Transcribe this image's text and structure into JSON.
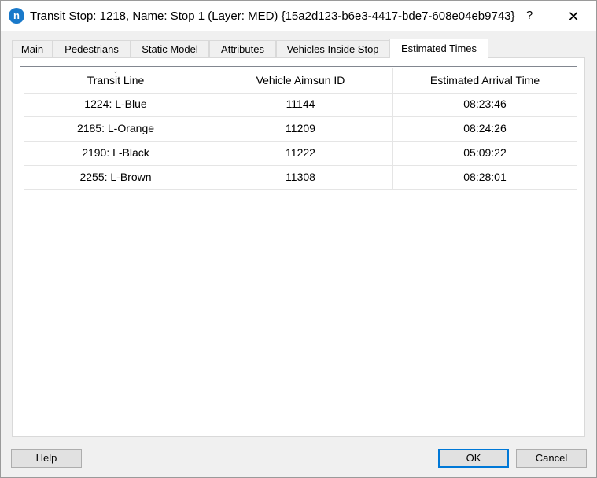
{
  "window": {
    "app_icon_letter": "n",
    "title": "Transit Stop: 1218, Name: Stop 1 (Layer: MED) {15a2d123-b6e3-4417-bde7-608e04eb9743}",
    "help_label": "?",
    "close_label": "✕"
  },
  "tabs": [
    {
      "label": "Main"
    },
    {
      "label": "Pedestrians"
    },
    {
      "label": "Static Model"
    },
    {
      "label": "Attributes"
    },
    {
      "label": "Vehicles Inside Stop"
    },
    {
      "label": "Estimated Times"
    }
  ],
  "active_tab": "Estimated Times",
  "table": {
    "columns": [
      "Transit Line",
      "Vehicle Aimsun ID",
      "Estimated Arrival Time"
    ],
    "rows": [
      [
        "1224: L-Blue",
        "11144",
        "08:23:46"
      ],
      [
        "2185: L-Orange",
        "11209",
        "08:24:26"
      ],
      [
        "2190: L-Black",
        "11222",
        "05:09:22"
      ],
      [
        "2255: L-Brown",
        "11308",
        "08:28:01"
      ]
    ]
  },
  "buttons": {
    "help": "Help",
    "ok": "OK",
    "cancel": "Cancel"
  },
  "colors": {
    "accent": "#0078d7",
    "app_icon": "#1979ca"
  }
}
